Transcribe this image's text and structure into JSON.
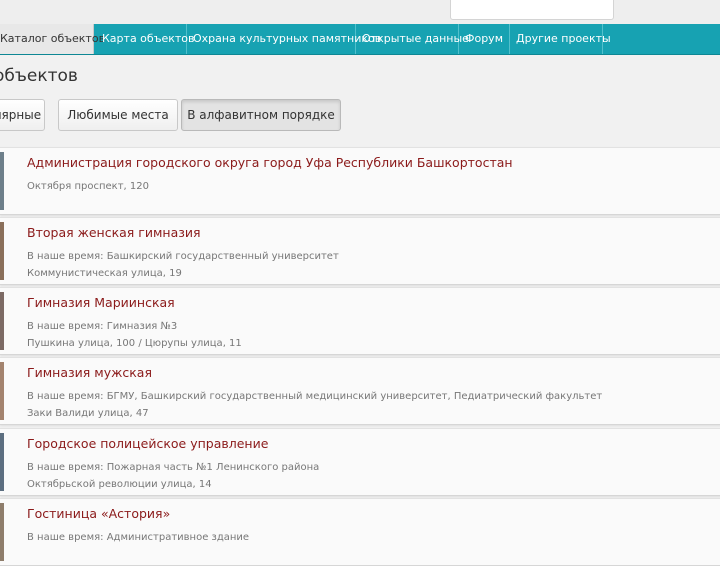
{
  "nav": {
    "items": [
      {
        "label": "Каталог объектов"
      },
      {
        "label": "Карта объектов"
      },
      {
        "label": "Охрана культурных памятников"
      },
      {
        "label": "Открытые данные"
      },
      {
        "label": "Форум"
      },
      {
        "label": "Другие проекты"
      }
    ]
  },
  "page": {
    "title": "объектов"
  },
  "sort": {
    "buttons": [
      {
        "label": "лярные"
      },
      {
        "label": "Любимые места"
      },
      {
        "label": "В алфавитном порядке"
      }
    ]
  },
  "objects": [
    {
      "title": "Администрация городского округа город Уфа Республики Башкортостан",
      "lines": [
        "Октября проспект, 120"
      ]
    },
    {
      "title": "Вторая женская гимназия",
      "lines": [
        "В наше время: Башкирский государственный университет",
        "Коммунистическая улица, 19"
      ]
    },
    {
      "title": "Гимназия Мариинская",
      "lines": [
        "В наше время: Гимназия №3",
        "Пушкина улица, 100 / Цюрупы улица, 11"
      ]
    },
    {
      "title": "Гимназия мужская",
      "lines": [
        "В наше время: БГМУ, Башкирский государственный медицинский университет, Педиатрический факультет",
        "Заки Валиди улица, 47"
      ]
    },
    {
      "title": "Городское полицейское управление",
      "lines": [
        "В наше время: Пожарная часть №1 Ленинского района",
        "Октябрьской революции улица, 14"
      ]
    },
    {
      "title": "Гостиница «Астория»",
      "lines": [
        "В наше время: Административное здание"
      ]
    }
  ],
  "colors": {
    "nav_bg": "#17a2b2",
    "title_link": "#8b1a1a",
    "thumbs": [
      "#6d7f8a",
      "#8a6f5a",
      "#7c6a64",
      "#a3836e",
      "#5c6e80",
      "#8e7d6b"
    ]
  }
}
